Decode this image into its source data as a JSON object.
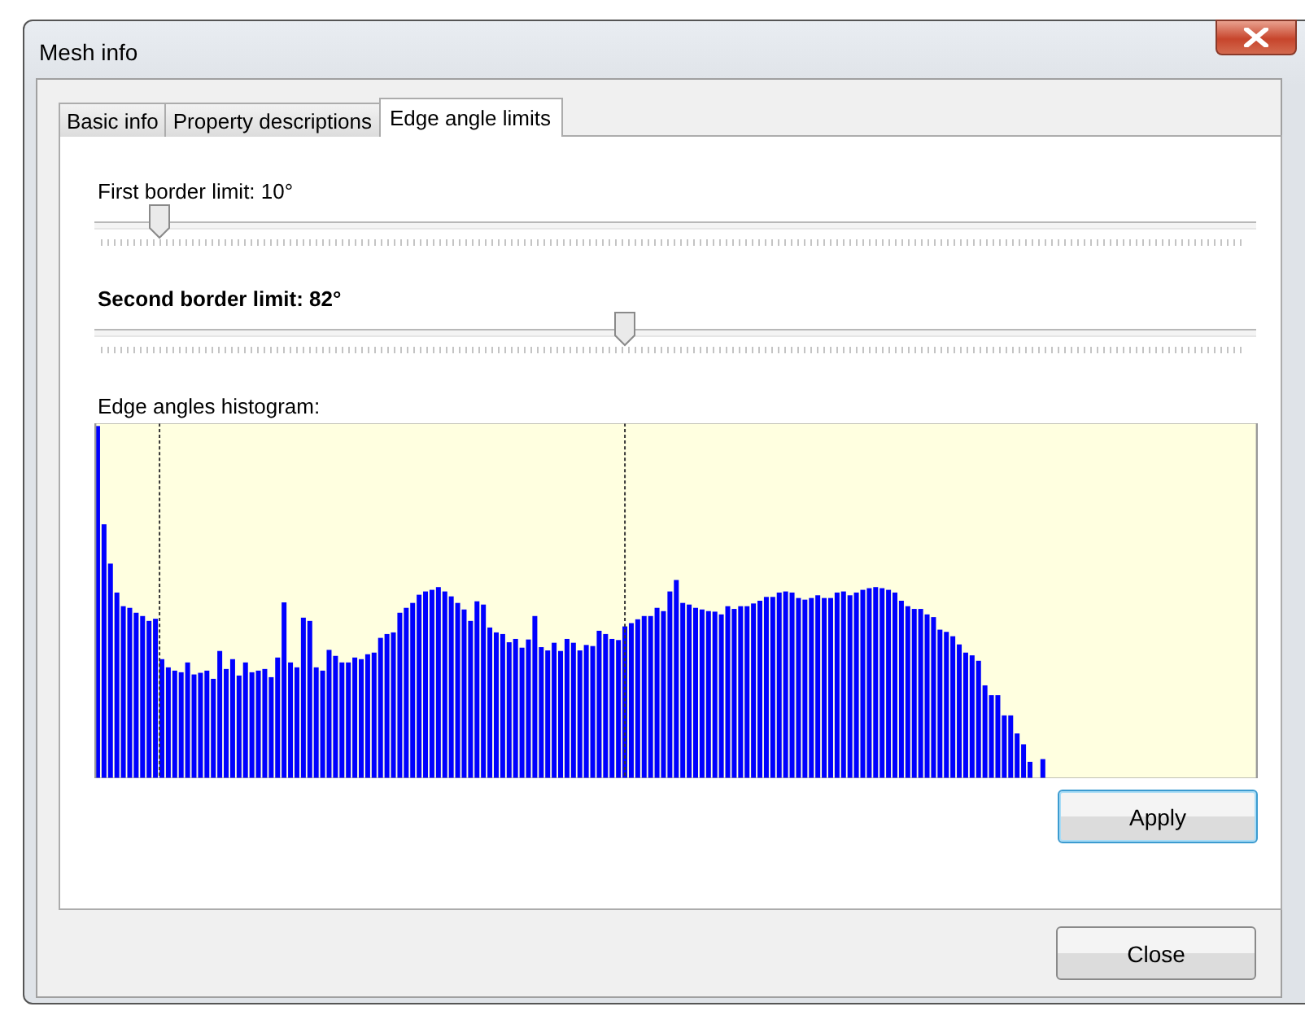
{
  "window": {
    "title": "Mesh info"
  },
  "tabs": [
    {
      "label": "Basic info",
      "selected": false
    },
    {
      "label": "Property descriptions",
      "selected": false
    },
    {
      "label": "Edge angle limits",
      "selected": true
    }
  ],
  "sliders": [
    {
      "label": "First border limit: 10°",
      "level": 0.056,
      "focused": false
    },
    {
      "label": "Second border limit: 82°",
      "level": 0.456,
      "focused": true
    }
  ],
  "histogram": {
    "label": "Edge angles histogram:"
  },
  "buttons": [
    {
      "label": "Apply",
      "default": true
    },
    {
      "label": "Close",
      "default": false
    }
  ]
}
